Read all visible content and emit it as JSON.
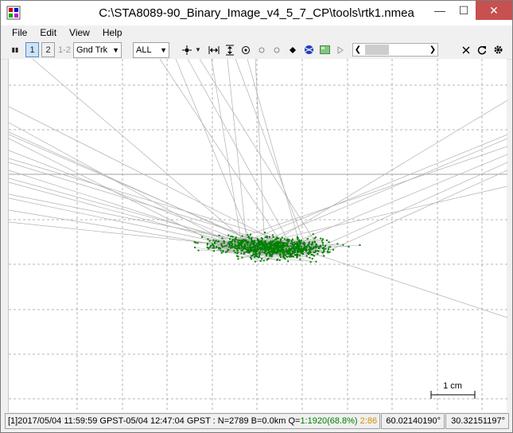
{
  "window": {
    "title": "C:\\STA8089-90_Binary_Image_v4_5_7_CP\\tools\\rtk1.nmea",
    "minimize_glyph": "—",
    "maximize_glyph": "☐",
    "close_glyph": "✕"
  },
  "menu": {
    "items": [
      {
        "label": "File"
      },
      {
        "label": "Edit"
      },
      {
        "label": "View"
      },
      {
        "label": "Help"
      }
    ]
  },
  "toolbar": {
    "pause_icon": "▮▮",
    "solution1_label": "1",
    "solution2_label": "2",
    "solution12_label": "1-2",
    "plot_type": "Gnd Trk",
    "quality_filter": "ALL",
    "icons": [
      "crosshair-icon",
      "fit-horizontal-icon",
      "fit-vertical-icon",
      "center-origin-icon",
      "circle-icon",
      "circle-icon",
      "point-icon",
      "globe-icon",
      "map-image-icon",
      "play-icon"
    ],
    "right_icons": [
      "close-icon",
      "refresh-icon",
      "gear-icon"
    ]
  },
  "plot": {
    "scale_label": "1 cm",
    "point_color": "#008000",
    "track_color": "#b0b0b0",
    "grid_color": "#a0a0a0"
  },
  "status": {
    "prefix": "[1]2017/05/04 11:59:59 GPST-05/04 12:47:04 GPST : N=2789 B=0.0km Q=",
    "q1": "1:1920(68.8%)",
    "q2": "2:86",
    "lat": "60.02140190°",
    "lon": "30.32151197°"
  }
}
